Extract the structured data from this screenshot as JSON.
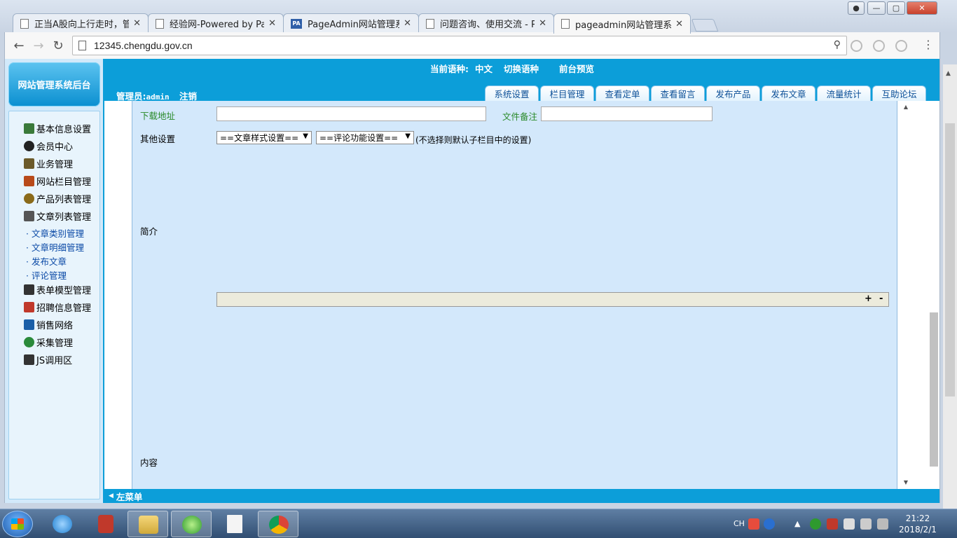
{
  "browser": {
    "tabs": [
      {
        "title": "正当A股向上行走时，管"
      },
      {
        "title": "经验网-Powered by Pa"
      },
      {
        "title": "PageAdmin网站管理系统"
      },
      {
        "title": "问题咨询、使用交流 - Pa"
      },
      {
        "title": "pageadmin网站管理系统"
      }
    ],
    "pa_favicon": "PA",
    "close_glyph": "✕",
    "url": "12345.chengdu.gov.cn"
  },
  "sidebar": {
    "logo": "网站管理系统后台",
    "items": [
      {
        "label": "基本信息设置",
        "icon": "info-settings-icon",
        "color": "#3a7a3a"
      },
      {
        "label": "会员中心",
        "icon": "members-icon",
        "color": "#222222"
      },
      {
        "label": "业务管理",
        "icon": "business-icon",
        "color": "#6b5a2a"
      },
      {
        "label": "网站栏目管理",
        "icon": "tools-icon",
        "color": "#b84a1a"
      },
      {
        "label": "产品列表管理",
        "icon": "gears-icon",
        "color": "#8a6a1a"
      },
      {
        "label": "文章列表管理",
        "icon": "printer-icon",
        "color": "#555555"
      }
    ],
    "subitems": [
      {
        "label": "· 文章类别管理"
      },
      {
        "label": "· 文章明细管理"
      },
      {
        "label": "· 发布文章"
      },
      {
        "label": "· 评论管理"
      }
    ],
    "items2": [
      {
        "label": "表单模型管理",
        "icon": "book-icon",
        "color": "#333333"
      },
      {
        "label": "招聘信息管理",
        "icon": "gift-icon",
        "color": "#c0392b"
      },
      {
        "label": "销售网络",
        "icon": "network-icon",
        "color": "#1a5fa8"
      },
      {
        "label": "采集管理",
        "icon": "globe-icon",
        "color": "#2a8a3a"
      },
      {
        "label": "JS调用区",
        "icon": "computer-icon",
        "color": "#333333"
      }
    ]
  },
  "header": {
    "current_lang_label": "当前语种:",
    "current_lang": "中文",
    "switch_lang": "切换语种",
    "preview": "前台预览",
    "admin_label": "管理员:",
    "admin_name": "admin",
    "logout": "注销",
    "tabs": [
      {
        "label": "系统设置"
      },
      {
        "label": "栏目管理"
      },
      {
        "label": "查看定单"
      },
      {
        "label": "查看留言"
      },
      {
        "label": "发布产品"
      },
      {
        "label": "发布文章"
      },
      {
        "label": "流量统计"
      },
      {
        "label": "互助论坛"
      }
    ]
  },
  "form": {
    "download_label": "下载地址",
    "download_value": "",
    "file_note_label": "文件备注",
    "file_note_value": "",
    "other_label": "其他设置",
    "style_select": "==文章样式设置==",
    "comment_select": "==评论功能设置==",
    "select_note": "(不选择则默认子栏目中的设置)",
    "intro_label": "简介",
    "plus": "+",
    "minus": "-",
    "content_label": "内容"
  },
  "footer": {
    "left_menu": "左菜单",
    "arrow": "◀"
  },
  "taskbar": {
    "lang": "CH",
    "time": "21:22",
    "date": "2018/2/1"
  }
}
